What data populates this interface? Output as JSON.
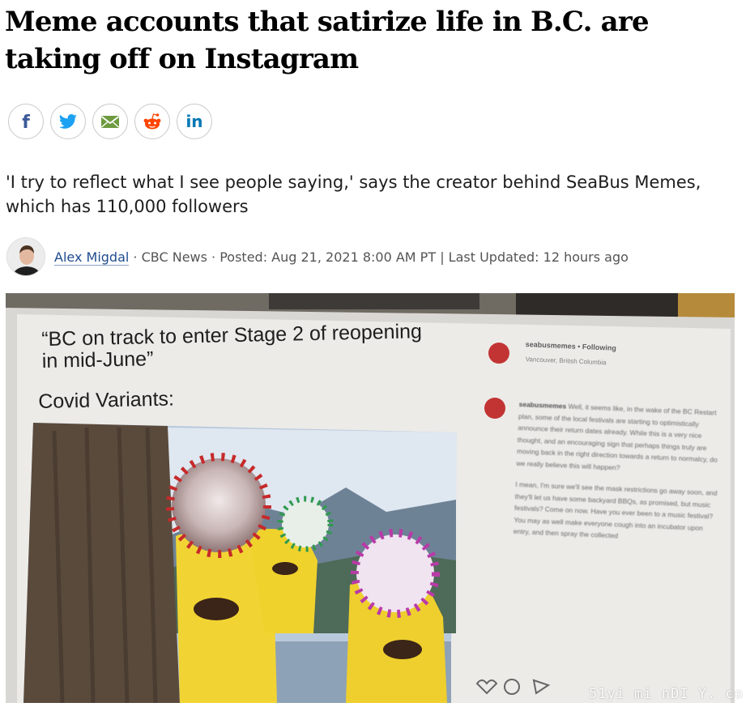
{
  "article": {
    "headline": "Meme accounts that satirize life in B.C. are taking off on Instagram",
    "deck": "'I try to reflect what I see people saying,' says the creator behind SeaBus Memes, which has 110,000 followers"
  },
  "share": {
    "buttons": [
      {
        "network": "facebook",
        "glyph": "f",
        "icon": "facebook-icon",
        "color": "#3b5998"
      },
      {
        "network": "twitter",
        "icon": "twitter-icon",
        "color": "#1da1f2"
      },
      {
        "network": "email",
        "icon": "email-icon",
        "color": "#5a8a3a"
      },
      {
        "network": "reddit",
        "icon": "reddit-icon",
        "color": "#ff4500"
      },
      {
        "network": "linkedin",
        "glyph": "in",
        "icon": "linkedin-icon",
        "color": "#0077b5"
      }
    ]
  },
  "byline": {
    "author": "Alex Migdal",
    "source": "· CBC News · Posted: Aug 21, 2021 8:00 AM PT | Last Updated: 12 hours ago"
  },
  "image": {
    "caption_line1": "“BC on track to enter Stage 2 of reopening",
    "caption_line2": "in mid-June”",
    "caption_line3": "Covid Variants:",
    "post": {
      "account_header": "seabusmemes • Following",
      "location": "Vancouver, British Columbia",
      "account": "seabusmemes",
      "paragraph1": "Well, it seems like, in the wake of the BC Restart plan, some of the local festivals are starting to optimistically announce their return dates already. While this is a very nice thought, and an encouraging sign that perhaps things truly are moving back in the right direction towards a return to normalcy, do we really believe this will happen?",
      "paragraph2": "I mean, I'm sure we'll see the mask restrictions go away soon, and they'll let us have some backyard BBQs, as promised, but music festivals? Come on now. Have you ever been to a music festival? You may as well make everyone cough into an incubator upon entry, and then spray the collected"
    }
  },
  "watermark": "51yi mi nDI Y. co"
}
